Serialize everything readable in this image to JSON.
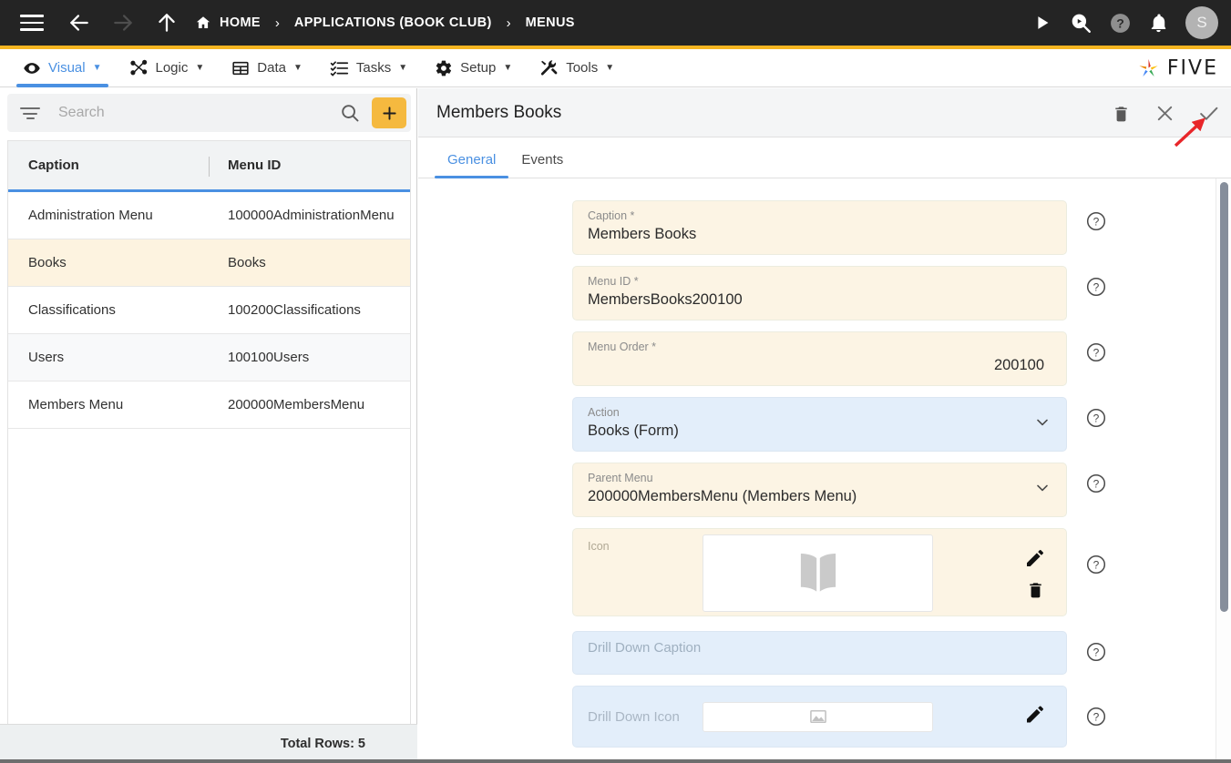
{
  "topbar": {
    "menu_icon": "hamburger-icon",
    "back_icon": "arrow-left-icon",
    "forward_icon": "arrow-right-icon",
    "up_icon": "arrow-up-icon",
    "home_label": "HOME",
    "separator": "›",
    "breadcrumbs": [
      {
        "label": "HOME",
        "icon": "home-icon"
      },
      {
        "label": "APPLICATIONS (BOOK CLUB)",
        "icon": ""
      },
      {
        "label": "MENUS",
        "icon": ""
      }
    ],
    "right_icons": [
      "run-icon",
      "search-debug-icon",
      "help-icon",
      "notifications-icon"
    ],
    "avatar_initial": "S",
    "accent_color": "#f5b521",
    "bar_color": "#242424"
  },
  "modulebar": {
    "tabs": [
      {
        "label": "Visual",
        "icon": "eye-icon",
        "caret": "▼",
        "active": true
      },
      {
        "label": "Logic",
        "icon": "logic-nodes-icon",
        "caret": "▼",
        "active": false
      },
      {
        "label": "Data",
        "icon": "table-icon",
        "caret": "▼",
        "active": false
      },
      {
        "label": "Tasks",
        "icon": "tasks-list-icon",
        "caret": "▼",
        "active": false
      },
      {
        "label": "Setup",
        "icon": "gear-icon",
        "caret": "▼",
        "active": false
      },
      {
        "label": "Tools",
        "icon": "tools-icon",
        "caret": "▼",
        "active": false
      }
    ],
    "brand_name": "FIVE",
    "active_color": "#4a90e2"
  },
  "sidebar": {
    "search": {
      "placeholder": "Search",
      "value": ""
    },
    "filter_icon": "filter-icon",
    "search_icon": "search-icon",
    "add_label": "+",
    "add_color": "#f5b93f",
    "columns": [
      "Caption",
      "Menu ID"
    ],
    "rows": [
      {
        "caption": "Administration Menu",
        "menu_id": "100000AdministrationMenu",
        "selected": false
      },
      {
        "caption": "Books",
        "menu_id": "Books",
        "selected": true
      },
      {
        "caption": "Classifications",
        "menu_id": "100200Classifications",
        "selected": false
      },
      {
        "caption": "Users",
        "menu_id": "100100Users",
        "selected": false
      },
      {
        "caption": "Members Menu",
        "menu_id": "200000MembersMenu",
        "selected": false
      }
    ],
    "total_rows_label": "Total Rows: 5",
    "selected_row_color": "#fdf3e0"
  },
  "detail": {
    "title": "Members Books",
    "actions": [
      {
        "name": "delete-button",
        "icon": "trash-icon"
      },
      {
        "name": "cancel-button",
        "icon": "close-icon"
      },
      {
        "name": "save-button",
        "icon": "check-icon"
      }
    ],
    "tabs": [
      {
        "label": "General",
        "active": true
      },
      {
        "label": "Events",
        "active": false
      }
    ],
    "fields": [
      {
        "label": "Caption *",
        "value": "Members Books",
        "type": "text",
        "tone": "cream",
        "help": "?"
      },
      {
        "label": "Menu ID *",
        "value": "MembersBooks200100",
        "type": "text",
        "tone": "cream",
        "help": "?"
      },
      {
        "label": "Menu Order *",
        "value": "200100",
        "type": "number",
        "tone": "cream",
        "help": "?"
      },
      {
        "label": "Action",
        "value": "Books (Form)",
        "type": "select",
        "tone": "blue",
        "help": "?"
      },
      {
        "label": "Parent Menu",
        "value": "200000MembersMenu (Members Menu)",
        "type": "select",
        "tone": "cream",
        "help": "?"
      },
      {
        "label": "Icon",
        "value": "",
        "type": "image",
        "tone": "cream",
        "help": "?",
        "image_icon": "open-book-icon"
      },
      {
        "label": "Drill Down Caption",
        "value": "",
        "type": "text",
        "tone": "blue",
        "help": "?"
      },
      {
        "label": "Drill Down Icon",
        "value": "",
        "type": "image-small",
        "tone": "blue",
        "help": "?",
        "image_icon": "image-placeholder-icon"
      }
    ],
    "cream_color": "#fcf4e4",
    "blue_color": "#e3eefa"
  },
  "annotation": {
    "type": "red-arrow",
    "color": "#e8262a",
    "points_to": "save-button"
  }
}
